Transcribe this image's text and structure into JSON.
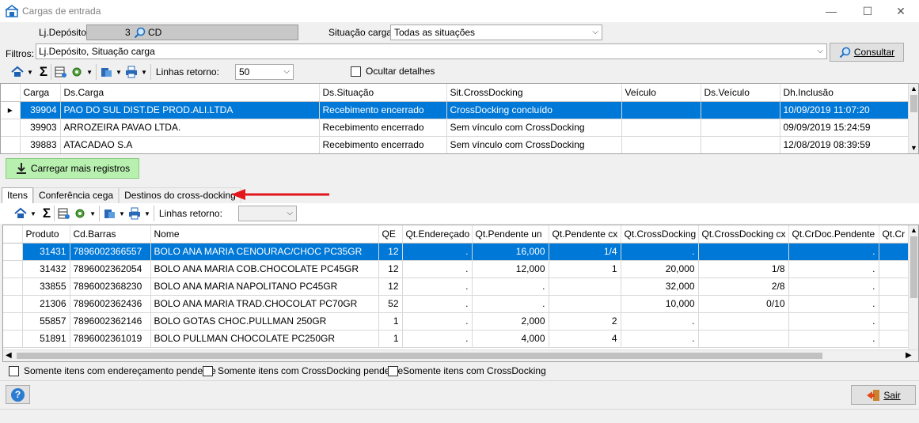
{
  "window": {
    "title": "Cargas de entrada",
    "minimize": "—",
    "maximize": "☐",
    "close": "✕"
  },
  "filters": {
    "lj_deposito_label": "Lj.Depósito",
    "lj_deposito_code": "3",
    "lj_deposito_value": "CD",
    "situacao_label": "Situação carga",
    "situacao_value": "Todas as situações",
    "filtros_label": "Filtros:",
    "filtros_value": "Lj.Depósito, Situação carga",
    "consultar_label": "Consultar"
  },
  "toolbar1": {
    "linhas_label": "Linhas retorno:",
    "linhas_value": "50",
    "ocultar_label": "Ocultar detalhes"
  },
  "cargas": {
    "columns": [
      "Carga",
      "Ds.Carga",
      "Ds.Situação",
      "Sit.CrossDocking",
      "Veículo",
      "Ds.Veículo",
      "Dh.Inclusão"
    ],
    "rows": [
      [
        "39904",
        "PAO DO SUL DIST.DE PROD.ALI.LTDA",
        "Recebimento encerrado",
        "CrossDocking concluído",
        "",
        "",
        "10/09/2019 11:07:20"
      ],
      [
        "39903",
        "ARROZEIRA PAVAO LTDA.",
        "Recebimento encerrado",
        "Sem vínculo com CrossDocking",
        "",
        "",
        "09/09/2019 15:24:59"
      ],
      [
        "39883",
        "ATACADAO S.A",
        "Recebimento encerrado",
        "Sem vínculo com CrossDocking",
        "",
        "",
        "12/08/2019 08:39:59"
      ]
    ]
  },
  "carregar_label": "Carregar mais registros",
  "tabs": [
    {
      "label": "Itens"
    },
    {
      "label": "Conferência cega"
    },
    {
      "label": "Destinos do cross-docking"
    }
  ],
  "toolbar2": {
    "linhas_label": "Linhas retorno:",
    "linhas_value": ""
  },
  "itens": {
    "columns": [
      "Produto",
      "Cd.Barras",
      "Nome",
      "QE",
      "Qt.Endereçado",
      "Qt.Pendente un",
      "Qt.Pendente cx",
      "Qt.CrossDocking",
      "Qt.CrossDocking cx",
      "Qt.CrDoc.Pendente",
      "Qt.Cr"
    ],
    "rows": [
      [
        "31431",
        "7896002366557",
        "BOLO ANA MARIA CENOURAC/CHOC PC35GR",
        "12",
        ".",
        "16,000",
        "1/4",
        ".",
        "",
        ".",
        ""
      ],
      [
        "31432",
        "7896002362054",
        "BOLO ANA MARIA COB.CHOCOLATE PC45GR",
        "12",
        ".",
        "12,000",
        "1",
        "20,000",
        "1/8",
        ".",
        ""
      ],
      [
        "33855",
        "7896002368230",
        "BOLO ANA MARIA NAPOLITANO PC45GR",
        "12",
        ".",
        ".",
        "",
        "32,000",
        "2/8",
        ".",
        ""
      ],
      [
        "21306",
        "7896002362436",
        "BOLO ANA MARIA TRAD.CHOCOLAT PC70GR",
        "52",
        ".",
        ".",
        "",
        "10,000",
        "0/10",
        ".",
        ""
      ],
      [
        "55857",
        "7896002362146",
        "BOLO GOTAS CHOC.PULLMAN 250GR",
        "1",
        ".",
        "2,000",
        "2",
        ".",
        "",
        ".",
        ""
      ],
      [
        "51891",
        "7896002361019",
        "BOLO PULLMAN CHOCOLATE PC250GR",
        "1",
        ".",
        "4,000",
        "4",
        ".",
        "",
        ".",
        ""
      ]
    ]
  },
  "checkboxes": [
    {
      "label": "Somente itens com endereçamento pendente"
    },
    {
      "label": "Somente itens com CrossDocking pendente"
    },
    {
      "label": "Somente itens com CrossDocking"
    }
  ],
  "help_label": "?",
  "sair_label": "Sair",
  "colors": {
    "selection": "#0078d7",
    "arrow": "#e3161b",
    "carregar_bg": "#b8f0b0"
  }
}
